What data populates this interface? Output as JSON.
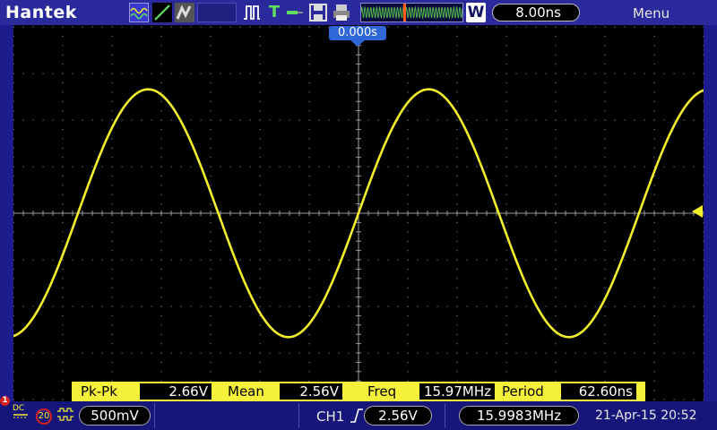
{
  "brand": "Hantek",
  "toolbar": {
    "icons": [
      "waveform-icon",
      "line-icon",
      "persistence-icon",
      "pulse-icon",
      "trigger-icon",
      "probe-icon",
      "save-icon",
      "print-icon"
    ]
  },
  "timebase": {
    "value": "8.00ns",
    "window_badge": "W"
  },
  "menu_label": "Menu",
  "trigger_position": "0.000s",
  "measurements": [
    {
      "label": "Pk-Pk",
      "value": "2.66V"
    },
    {
      "label": "Mean",
      "value": "2.56V"
    },
    {
      "label": "Freq",
      "value": "15.97MHz"
    },
    {
      "label": "Period",
      "value": "62.60ns"
    }
  ],
  "channel": {
    "number": "1",
    "coupling": "DC",
    "bandwidth_limit": "20",
    "volts_per_div": "500mV"
  },
  "trigger": {
    "source": "CH1",
    "level": "2.56V",
    "frequency": "15.9983MHz"
  },
  "datetime": "21-Apr-15 20:52",
  "colors": {
    "trace": "#f2ee2c",
    "background": "#000000",
    "chrome": "#1c1c8c",
    "trigger_badge": "#2f66d8"
  },
  "chart_data": {
    "type": "line",
    "title": "",
    "xlabel": "",
    "ylabel": "",
    "grid": true,
    "x_divisions": 14,
    "y_divisions": 8,
    "series": [
      {
        "x_div": [
          -7.0,
          -6.5,
          -6.0,
          -5.5,
          -5.0,
          -4.5,
          -4.0,
          -3.5,
          -3.0,
          -2.5,
          -2.0,
          -1.5,
          -1.0,
          -0.5,
          0.0,
          0.5,
          1.0,
          1.5,
          2.0,
          2.5,
          3.0,
          3.5,
          4.0,
          4.5,
          5.0,
          5.5,
          6.0,
          6.5,
          7.0
        ],
        "y_div": [
          -2.43,
          -1.48,
          -0.15,
          1.22,
          2.27,
          2.66,
          2.28,
          1.24,
          -0.13,
          -1.46,
          -2.42,
          -2.65,
          -2.03,
          -0.85,
          0.0,
          1.08,
          2.17,
          2.64,
          2.38,
          1.47,
          0.12,
          -1.23,
          -2.28,
          -2.66,
          -2.27,
          -1.21,
          0.17,
          1.49,
          2.44
        ]
      }
    ]
  }
}
